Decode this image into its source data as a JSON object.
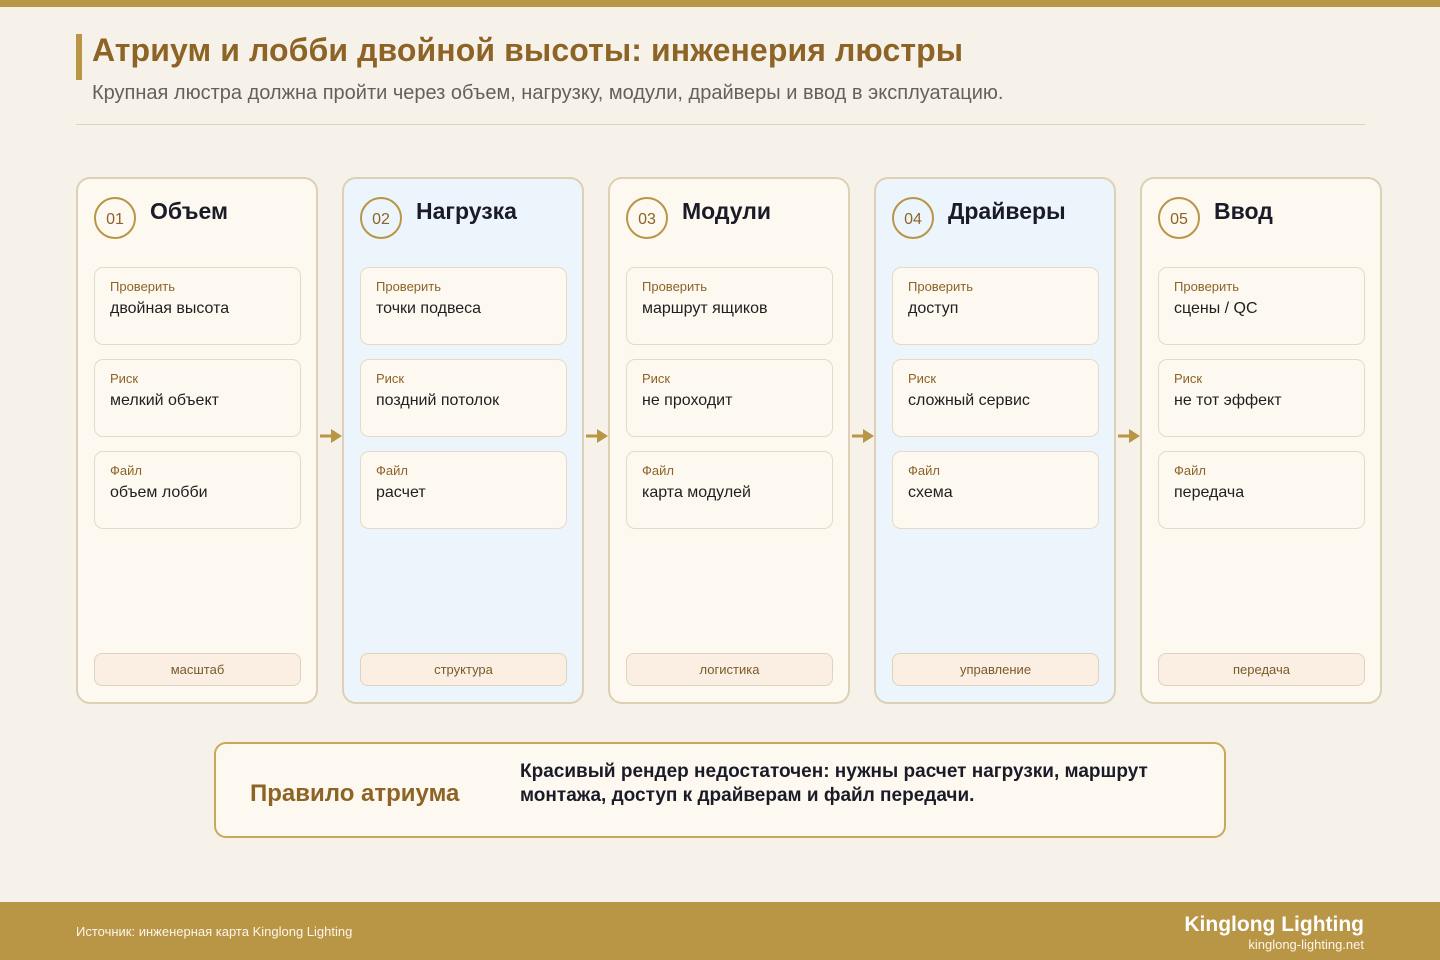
{
  "header": {
    "title": "Атриум и лобби двойной высоты: инженерия люстры",
    "subtitle": "Крупная люстра должна пройти через объем, нагрузку, модули, драйверы и ввод в эксплуатацию."
  },
  "field_labels": {
    "check": "Проверить",
    "risk": "Риск",
    "file": "Файл"
  },
  "steps": [
    {
      "num": "01",
      "title": "Объем",
      "check": "двойная высота",
      "risk": "мелкий объект",
      "file": "объем лобби",
      "tag": "масштаб"
    },
    {
      "num": "02",
      "title": "Нагрузка",
      "check": "точки подвеса",
      "risk": "поздний потолок",
      "file": "расчет",
      "tag": "структура"
    },
    {
      "num": "03",
      "title": "Модули",
      "check": "маршрут ящиков",
      "risk": "не проходит",
      "file": "карта модулей",
      "tag": "логистика"
    },
    {
      "num": "04",
      "title": "Драйверы",
      "check": "доступ",
      "risk": "сложный сервис",
      "file": "схема",
      "tag": "управление"
    },
    {
      "num": "05",
      "title": "Ввод",
      "check": "сцены / QC",
      "risk": "не тот эффект",
      "file": "передача",
      "tag": "передача"
    }
  ],
  "rule": {
    "label": "Правило атриума",
    "text": "Красивый рендер недостаточен: нужны расчет нагрузки, маршрут монтажа, доступ к драйверам и файл передачи."
  },
  "footer": {
    "source": "Источник: инженерная карта Kinglong Lighting",
    "brand": "Kinglong Lighting",
    "site": "kinglong-lighting.net"
  },
  "colors": {
    "accent": "#b99546",
    "title": "#8d6326",
    "card_bg": "#fdf9f1",
    "card_alt_bg": "#ecf5fb"
  }
}
